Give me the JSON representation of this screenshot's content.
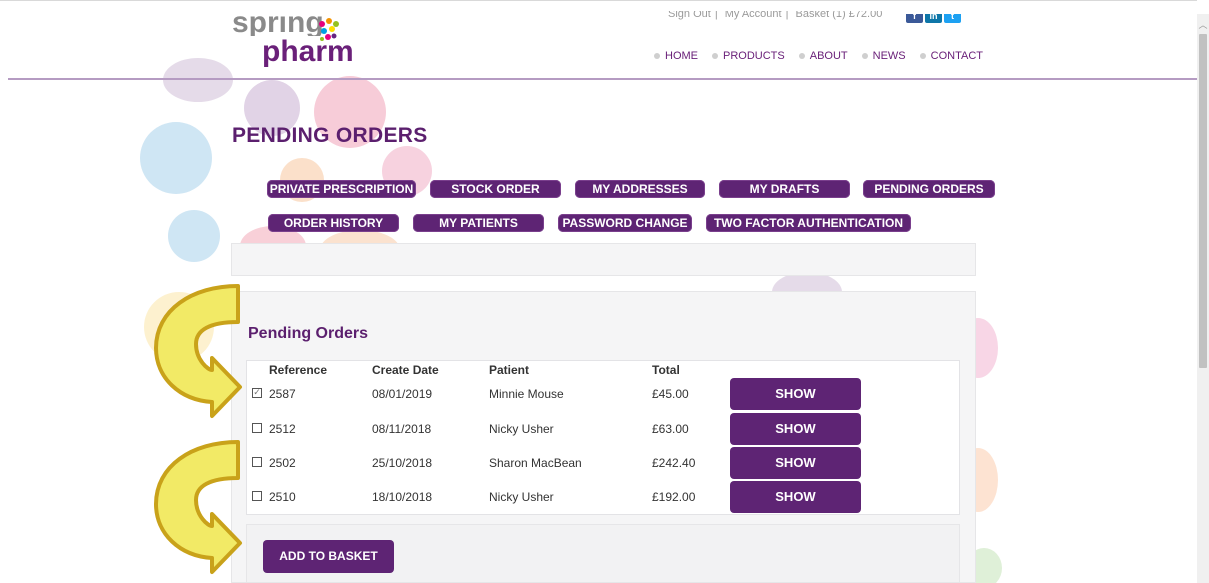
{
  "header": {
    "logo": {
      "line1": "spring",
      "line2": "pharm"
    },
    "util_links": [
      "Sign Out",
      "My Account",
      "Basket (1) £72.00"
    ],
    "social_icons": [
      "facebook-icon",
      "linkedin-icon",
      "twitter-icon"
    ],
    "nav": [
      "HOME",
      "PRODUCTS",
      "ABOUT",
      "NEWS",
      "CONTACT"
    ]
  },
  "page": {
    "title": "PENDING ORDERS",
    "tabs": [
      "PRIVATE PRESCRIPTION",
      "STOCK ORDER",
      "MY ADDRESSES",
      "MY DRAFTS",
      "PENDING ORDERS",
      "ORDER HISTORY",
      "MY PATIENTS",
      "PASSWORD CHANGE",
      "TWO FACTOR AUTHENTICATION"
    ]
  },
  "orders": {
    "section_title": "Pending Orders",
    "columns": [
      "Reference",
      "Create Date",
      "Patient",
      "Total"
    ],
    "rows": [
      {
        "checked": true,
        "reference": "2587",
        "date": "08/01/2019",
        "patient": "Minnie Mouse",
        "total": "£45.00",
        "action": "SHOW"
      },
      {
        "checked": false,
        "reference": "2512",
        "date": "08/11/2018",
        "patient": "Nicky Usher",
        "total": "£63.00",
        "action": "SHOW"
      },
      {
        "checked": false,
        "reference": "2502",
        "date": "25/10/2018",
        "patient": "Sharon MacBean",
        "total": "£242.40",
        "action": "SHOW"
      },
      {
        "checked": false,
        "reference": "2510",
        "date": "18/10/2018",
        "patient": "Nicky Usher",
        "total": "£192.00",
        "action": "SHOW"
      }
    ],
    "add_button": "ADD TO BASKET"
  },
  "colors": {
    "brand_purple": "#5e2474",
    "title_purple": "#5b1f6e",
    "arrow_gold": "#c9a21a",
    "arrow_fill": "#f2ea66"
  }
}
